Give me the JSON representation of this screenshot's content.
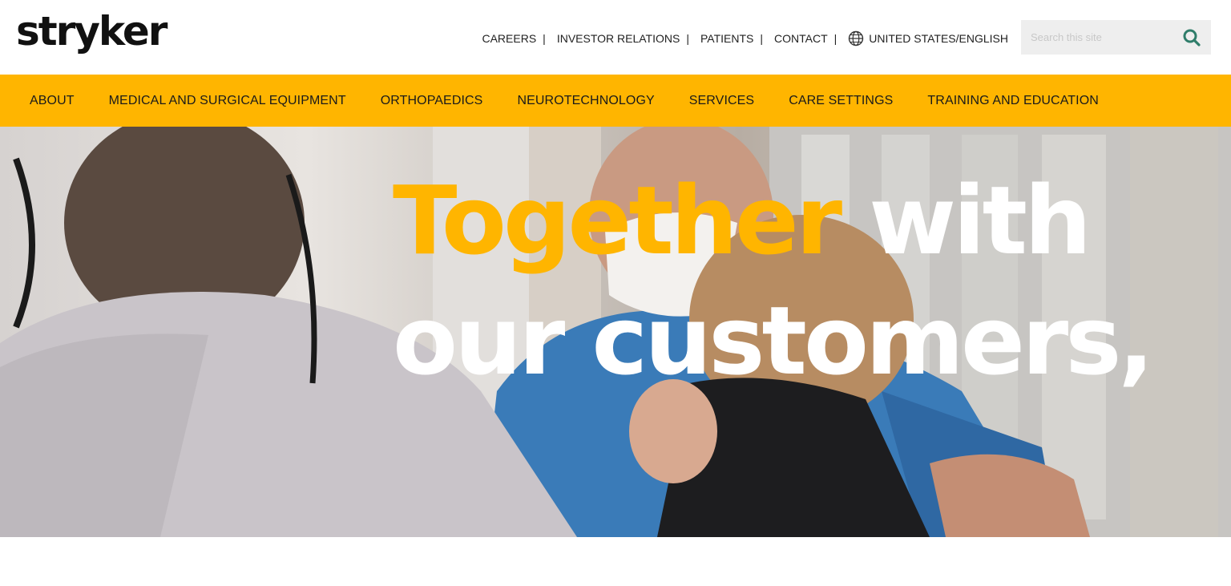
{
  "logo": {
    "text": "stryker"
  },
  "utility_nav": {
    "links": [
      "CAREERS",
      "INVESTOR RELATIONS",
      "PATIENTS",
      "CONTACT"
    ],
    "separator": "|",
    "region": "UNITED STATES/ENGLISH"
  },
  "search": {
    "placeholder": "Search this site"
  },
  "main_nav": {
    "items": [
      "ABOUT",
      "MEDICAL AND SURGICAL EQUIPMENT",
      "ORTHOPAEDICS",
      "NEUROTECHNOLOGY",
      "SERVICES",
      "CARE SETTINGS",
      "TRAINING AND EDUCATION"
    ]
  },
  "hero": {
    "headline_yellow": "Together",
    "headline_white_1": "with",
    "headline_white_2": "our customers,"
  },
  "colors": {
    "brand_yellow": "#ffb500",
    "search_icon": "#2f7d6a"
  },
  "icons": {
    "region": "globe-icon",
    "search": "search-icon"
  }
}
